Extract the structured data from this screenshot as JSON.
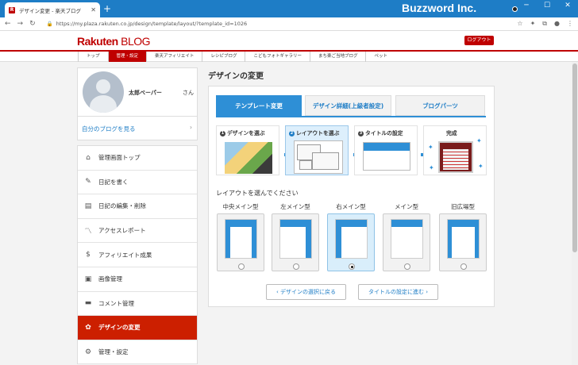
{
  "browser": {
    "tab_title": "デザイン変更 - 楽天ブログ",
    "url": "https://my.plaza.rakuten.co.jp/design/template/layout/?template_id=1026",
    "overlay_brand": "Buzzword Inc."
  },
  "header": {
    "logo_main": "Rakuten",
    "logo_sub": "BLOG",
    "logout_label": "ログアウト",
    "nav": [
      "トップ",
      "管理・設定",
      "楽天アフィリエイト",
      "レシピブログ",
      "こどもフォトギャラリー",
      "まち楽ご当地ブログ",
      "ペット"
    ],
    "active_nav": "管理・設定"
  },
  "profile": {
    "name": "太郎ベーパー",
    "honorific": "さん",
    "my_blog_link": "自分のブログを見る"
  },
  "menu": [
    {
      "label": "管理画面トップ",
      "icon": "home-icon"
    },
    {
      "label": "日記を書く",
      "icon": "pencil-icon"
    },
    {
      "label": "日記の編集・削除",
      "icon": "document-icon"
    },
    {
      "label": "アクセスレポート",
      "icon": "chart-line-icon"
    },
    {
      "label": "アフィリエイト成果",
      "icon": "money-bag-icon"
    },
    {
      "label": "画像管理",
      "icon": "image-icon"
    },
    {
      "label": "コメント管理",
      "icon": "comment-icon"
    },
    {
      "label": "デザインの変更",
      "icon": "palette-icon",
      "active": true
    },
    {
      "label": "管理・設定",
      "icon": "gear-icon"
    }
  ],
  "main": {
    "title": "デザインの変更",
    "tabs": [
      "テンプレート変更",
      "デザイン詳細(上級者設定)",
      "ブログパーツ"
    ],
    "steps": [
      "デザインを選ぶ",
      "レイアウトを選ぶ",
      "タイトルの設定",
      "完成"
    ],
    "step_numbers": [
      "1",
      "2",
      "3"
    ],
    "choose_label": "レイアウトを選んでください",
    "layouts": [
      "中央メイン型",
      "左メイン型",
      "右メイン型",
      "メイン型",
      "旧広場型"
    ],
    "selected_layout": "右メイン型",
    "back_button": "デザインの選択に戻る",
    "next_button": "タイトルの設定に進む"
  },
  "colors": {
    "accent": "#2e8fd6",
    "brand": "#bf0000",
    "active_menu": "#cc1f00"
  }
}
